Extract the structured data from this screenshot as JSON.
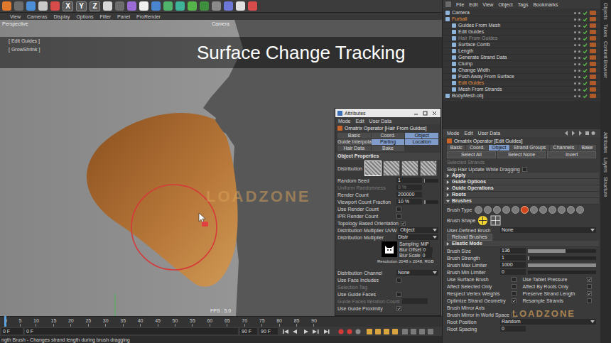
{
  "toolbar": {
    "axes": [
      "X",
      "Y",
      "Z"
    ]
  },
  "viewport": {
    "menu": [
      "View",
      "Cameras",
      "Display",
      "Options",
      "Filter",
      "Panel",
      "ProRender"
    ],
    "label": "Perspective",
    "camera": "Camera",
    "hud": [
      "[ Edit Guides ]",
      "[ GrowShrink ]"
    ],
    "banner": "Surface Change Tracking",
    "fps": "FPS : 5.0",
    "watermark": "LOADZONE"
  },
  "float_window": {
    "title": "Attributes",
    "menu": [
      "Mode",
      "Edit",
      "User Data"
    ],
    "object": "Ornatrix Operator [Hair From Guides]",
    "tabs": [
      {
        "label": "Basic",
        "selected": false
      },
      {
        "label": "Coord.",
        "selected": false
      },
      {
        "label": "Object",
        "selected": true
      },
      {
        "label": "Guide Interpolation",
        "selected": false
      },
      {
        "label": "Parting",
        "selected": true
      },
      {
        "label": "Location",
        "selected": true
      },
      {
        "label": "Hair Data",
        "selected": false
      },
      {
        "label": "Bake",
        "selected": false
      }
    ],
    "section": "Object Properties",
    "rows": [
      {
        "kind": "swatches",
        "label": "Distribution",
        "items": [
          {
            "selected": true
          },
          {
            "selected": false
          },
          {
            "selected": false
          },
          {
            "selected": false
          }
        ]
      },
      {
        "kind": "number",
        "label": "Random Seed",
        "value": "1",
        "level": 0.05,
        "disabled": false
      },
      {
        "kind": "number",
        "label": "Uniform Randomness",
        "value": "0 %",
        "disabled": true
      },
      {
        "kind": "number",
        "label": "Render Count",
        "value": "200000",
        "disabled": false
      },
      {
        "kind": "number",
        "label": "Viewport Count Fraction",
        "value": "10 %",
        "level": 0.1,
        "disabled": false
      },
      {
        "kind": "check",
        "label": "Use Render Count",
        "checked": false
      },
      {
        "kind": "check",
        "label": "IPR Render Count",
        "checked": false
      },
      {
        "kind": "check",
        "label": "Topology Based Orientation",
        "checked": true
      },
      {
        "kind": "select",
        "label": "Distribution Multiplier UVW",
        "value": "Object"
      },
      {
        "kind": "select",
        "label": "Distribution Multiplier",
        "value": "Distr"
      },
      {
        "kind": "texture",
        "entries": [
          {
            "label": "Sampling",
            "value": "MIP"
          },
          {
            "label": "Blur Offset",
            "value": "0"
          },
          {
            "label": "Blur Scale",
            "value": "0"
          }
        ],
        "resolution": "Resolution 2048 x 2048, RGB"
      },
      {
        "kind": "select",
        "label": "Distribution Channel",
        "value": "None"
      },
      {
        "kind": "check",
        "label": "Use Face Includes",
        "checked": false
      },
      {
        "kind": "label",
        "label": "Selection Tag",
        "disabled": true
      },
      {
        "kind": "check",
        "label": "Use Guide Faces",
        "checked": false
      },
      {
        "kind": "number",
        "label": "Guide Faces Iteration Count",
        "value": "",
        "disabled": true
      },
      {
        "kind": "check",
        "label": "Use Guide Proximity",
        "checked": true
      }
    ]
  },
  "timeline": {
    "ticks": [
      "0",
      "5",
      "10",
      "15",
      "20",
      "25",
      "30",
      "35",
      "40",
      "45",
      "50",
      "55",
      "60",
      "65",
      "70",
      "75",
      "80",
      "85",
      "90"
    ],
    "level": 0
  },
  "transport": {
    "fields": [
      "0 F",
      "0 F",
      "90 F",
      "90 F"
    ]
  },
  "status_bar": "ngth Brush - Changes strand length during brush dragging",
  "object_manager": {
    "menu": [
      "File",
      "Edit",
      "View",
      "Object",
      "Tags",
      "Bookmarks"
    ],
    "objects": [
      {
        "name": "Camera",
        "depth": 0,
        "color": "#d8d8d8",
        "enabled": true
      },
      {
        "name": "Furball",
        "depth": 0,
        "color": "#e3913f",
        "enabled": true
      },
      {
        "name": "Guides From Mesh",
        "depth": 1,
        "color": "#d8d8d8",
        "enabled": true
      },
      {
        "name": "Edit Guides",
        "depth": 1,
        "color": "#d8d8d8",
        "enabled": true
      },
      {
        "name": "Hair From Guides",
        "depth": 1,
        "color": "#8f8f8f",
        "enabled": true
      },
      {
        "name": "Surface Comb",
        "depth": 1,
        "color": "#d8d8d8",
        "enabled": true
      },
      {
        "name": "Length",
        "depth": 1,
        "color": "#d8d8d8",
        "enabled": true
      },
      {
        "name": "Generate Strand Data",
        "depth": 1,
        "color": "#d8d8d8",
        "enabled": true
      },
      {
        "name": "Clump",
        "depth": 1,
        "color": "#d8d8d8",
        "enabled": true
      },
      {
        "name": "Change Width",
        "depth": 1,
        "color": "#d8d8d8",
        "enabled": true
      },
      {
        "name": "Push Away From Surface",
        "depth": 1,
        "color": "#d8d8d8",
        "enabled": true
      },
      {
        "name": "Edit Guides",
        "depth": 1,
        "color": "#e3913f",
        "enabled": true
      },
      {
        "name": "Mesh From Strands",
        "depth": 1,
        "color": "#d8d8d8",
        "enabled": true
      },
      {
        "name": "BodyMesh.obj",
        "depth": 0,
        "color": "#d8d8d8",
        "enabled": true
      }
    ]
  },
  "attributes": {
    "menu": [
      "Mode",
      "Edit",
      "User Data"
    ],
    "object": "Ornatrix Operator [Edit Guides]",
    "tabs": [
      {
        "label": "Basic",
        "selected": false
      },
      {
        "label": "Coord.",
        "selected": false
      },
      {
        "label": "Object",
        "selected": true
      },
      {
        "label": "Strand Groups",
        "selected": false
      },
      {
        "label": "Channels",
        "selected": false
      },
      {
        "label": "Bake",
        "selected": false
      }
    ],
    "rows": [
      {
        "kind": "buttons",
        "items": [
          "Select All",
          "Select None",
          "Invert"
        ]
      },
      {
        "kind": "label",
        "label": "Selected Strands",
        "disabled": true
      },
      {
        "kind": "check",
        "label": "Skip Hair Update While Dragging",
        "checked": false
      },
      {
        "kind": "header",
        "label": "Apply",
        "expanded": false
      },
      {
        "kind": "header",
        "label": "Guide Options",
        "expanded": false
      },
      {
        "kind": "header",
        "label": "Guide Operations",
        "expanded": false
      },
      {
        "kind": "header",
        "label": "Roots",
        "expanded": false
      },
      {
        "kind": "header",
        "label": "Brushes",
        "expanded": true
      },
      {
        "kind": "brush_types",
        "label": "Brush Type",
        "items": [
          {
            "selected": false
          },
          {
            "selected": false
          },
          {
            "selected": false
          },
          {
            "selected": false
          },
          {
            "selected": false
          },
          {
            "selected": true
          },
          {
            "selected": false
          },
          {
            "selected": false
          },
          {
            "selected": false
          },
          {
            "selected": false
          },
          {
            "selected": false
          },
          {
            "selected": false
          }
        ]
      },
      {
        "kind": "brush_shapes",
        "label": "Brush Shape",
        "items": [
          {
            "selected": true
          },
          {
            "selected": false
          }
        ]
      },
      {
        "kind": "select",
        "label": "User-Defined Brush",
        "value": "None"
      },
      {
        "kind": "buttons",
        "items": [
          "Reload Brushes"
        ]
      },
      {
        "kind": "header",
        "label": "Elastic Mode",
        "expanded": false
      },
      {
        "kind": "number",
        "label": "Brush Size",
        "value": "136",
        "level": 0.55,
        "disabled": false
      },
      {
        "kind": "number",
        "label": "Brush Strength",
        "value": "1",
        "level": 0.02,
        "disabled": false
      },
      {
        "kind": "number",
        "label": "Brush Max Limiter",
        "value": "1000",
        "level": 1,
        "disabled": false
      },
      {
        "kind": "number",
        "label": "Brush Min Limiter",
        "value": "0",
        "level": 0,
        "disabled": false
      },
      {
        "kind": "checks2",
        "items": [
          {
            "label": "Use Surface Brush",
            "checked": false
          },
          {
            "label": "Use Tablet Pressure",
            "checked": true
          }
        ]
      },
      {
        "kind": "checks2",
        "items": [
          {
            "label": "Affect Selected Only",
            "checked": false
          },
          {
            "label": "Affect By Roots Only",
            "checked": false
          }
        ]
      },
      {
        "kind": "checks2",
        "items": [
          {
            "label": "Respect Vertex Weights",
            "checked": false
          },
          {
            "label": "Preserve Strand Length",
            "checked": true
          }
        ]
      },
      {
        "kind": "checks2",
        "items": [
          {
            "label": "Optimize Strand Geometry",
            "checked": true
          },
          {
            "label": "Resample Strands",
            "checked": false
          }
        ]
      },
      {
        "kind": "label",
        "label": "Brush Mirror Axis",
        "disabled": false
      },
      {
        "kind": "check",
        "label": "Brush Mirror in World Space",
        "checked": false
      },
      {
        "kind": "select",
        "label": "Root Position",
        "value": "Random"
      },
      {
        "kind": "number",
        "label": "Root Spacing",
        "value": "0",
        "disabled": false
      }
    ],
    "watermark": "LOADZONE"
  },
  "side_tabs": {
    "top": [
      "Objects",
      "Takes",
      "Content Browser"
    ],
    "bottom": [
      "Attributes",
      "Layers",
      "Structure"
    ]
  }
}
